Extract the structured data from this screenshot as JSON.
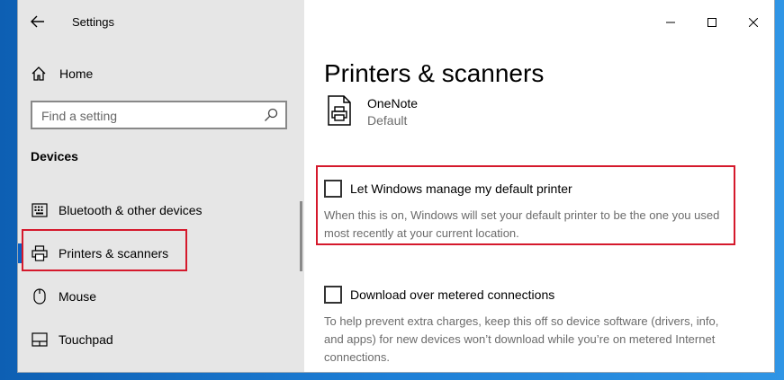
{
  "window": {
    "title": "Settings"
  },
  "sidebar": {
    "home_label": "Home",
    "search_placeholder": "Find a setting",
    "section_header": "Devices",
    "items": [
      {
        "label": "Bluetooth & other devices",
        "icon": "keyboard-icon"
      },
      {
        "label": "Printers & scanners",
        "icon": "printer-icon",
        "selected": true
      },
      {
        "label": "Mouse",
        "icon": "mouse-icon"
      },
      {
        "label": "Touchpad",
        "icon": "touchpad-icon"
      }
    ]
  },
  "main": {
    "title": "Printers & scanners",
    "printer": {
      "name": "OneNote",
      "status": "Default"
    },
    "options": [
      {
        "label": "Let Windows manage my default printer",
        "checked": false,
        "description": "When this is on, Windows will set your default printer to be the one you used most recently at your current location."
      },
      {
        "label": "Download over metered connections",
        "checked": false,
        "description": "To help prevent extra charges, keep this off so device software (drivers, info, and apps) for new devices won’t download while you’re on metered Internet connections."
      }
    ]
  },
  "colors": {
    "highlight": "#d5192c",
    "accent": "#0b62c4",
    "sidebar_bg": "#e6e6e6"
  }
}
